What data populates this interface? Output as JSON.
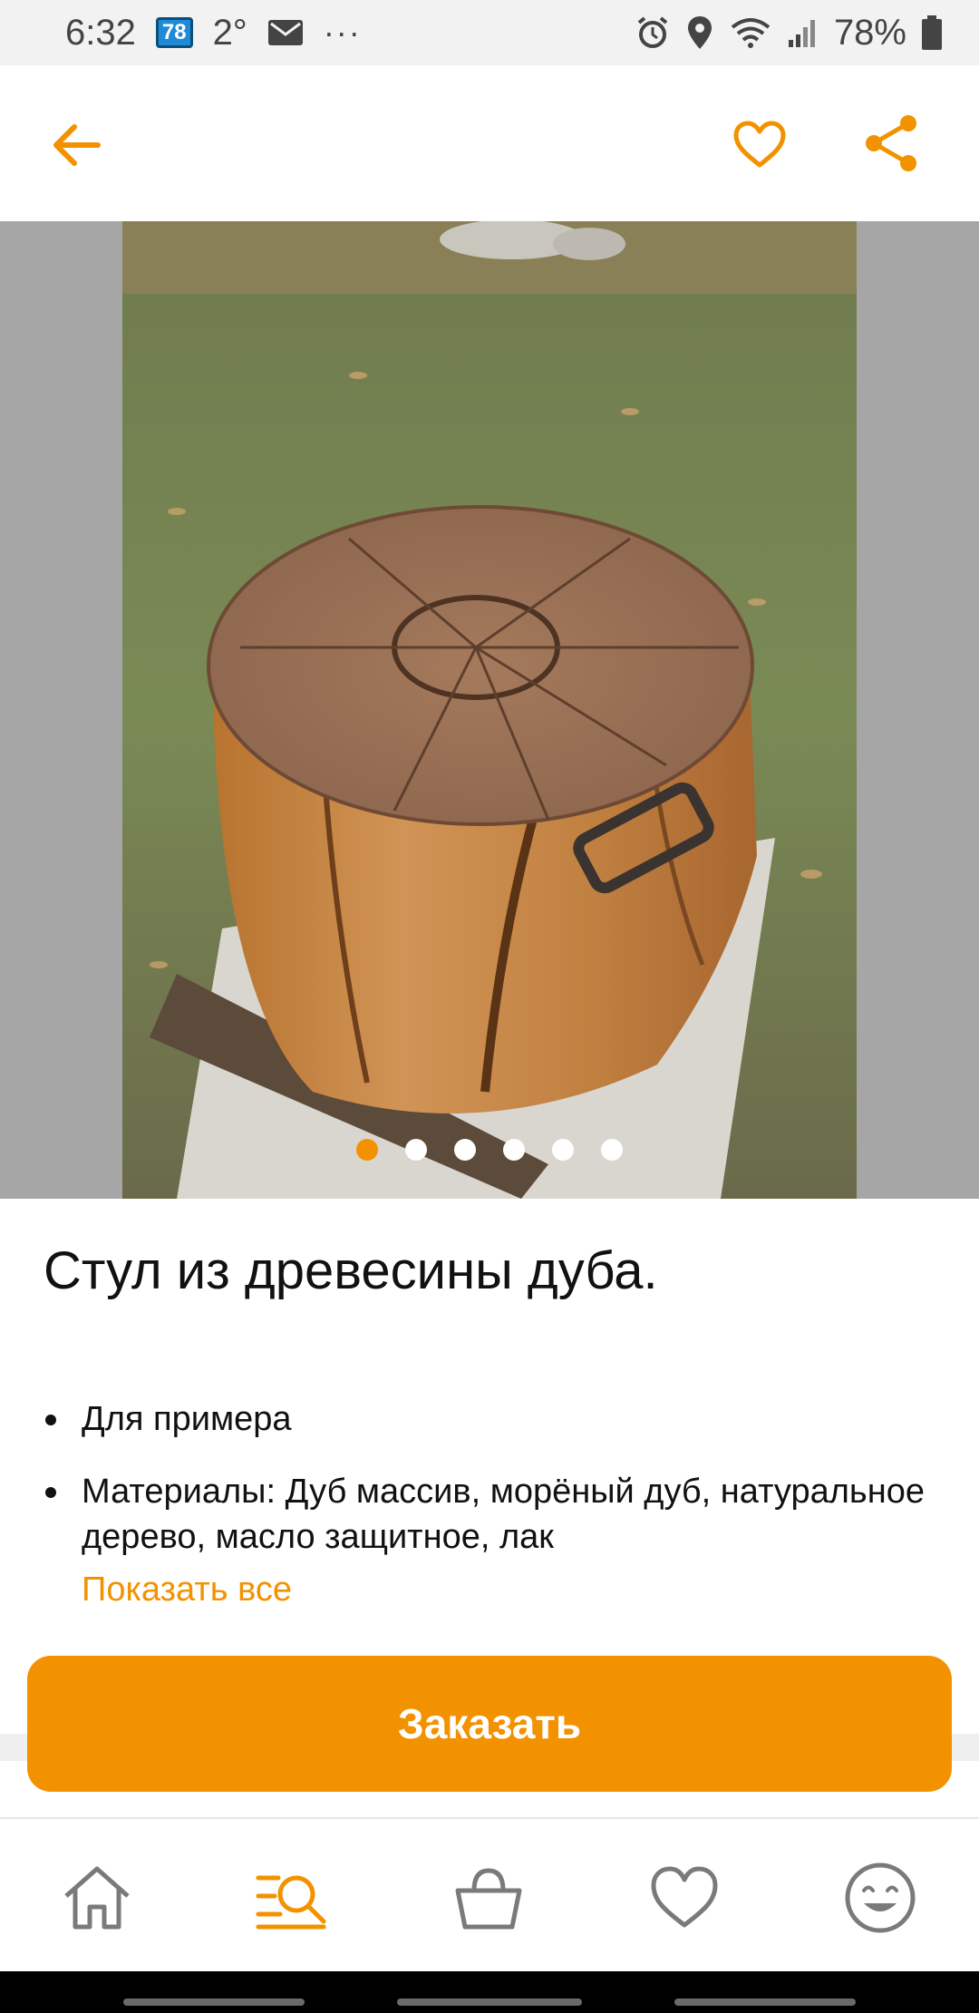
{
  "status_bar": {
    "time": "6:32",
    "badge": "78",
    "temperature": "2°",
    "more": "···",
    "battery": "78%"
  },
  "app_bar": {
    "icons": [
      "back-arrow-icon",
      "heart-icon",
      "share-icon"
    ]
  },
  "gallery": {
    "dots_total": 6,
    "active_index": 0
  },
  "product": {
    "title": "Стул из древесины дуба.",
    "bullets": [
      "Для примера",
      "Материалы: Дуб массив, морёный дуб, натуральное дерево, масло защитное, лак"
    ],
    "show_all": "Показать все"
  },
  "order_button": {
    "label": "Заказать"
  },
  "bottom_nav": {
    "items": [
      "home-icon",
      "catalog-search-icon",
      "basket-icon",
      "heart-icon",
      "smiley-profile-icon"
    ],
    "active": "catalog-search-icon"
  },
  "colors": {
    "accent": "#f39200",
    "gallery_bg": "#a6a6a6",
    "status_bar_bg": "#f2f2f2"
  }
}
